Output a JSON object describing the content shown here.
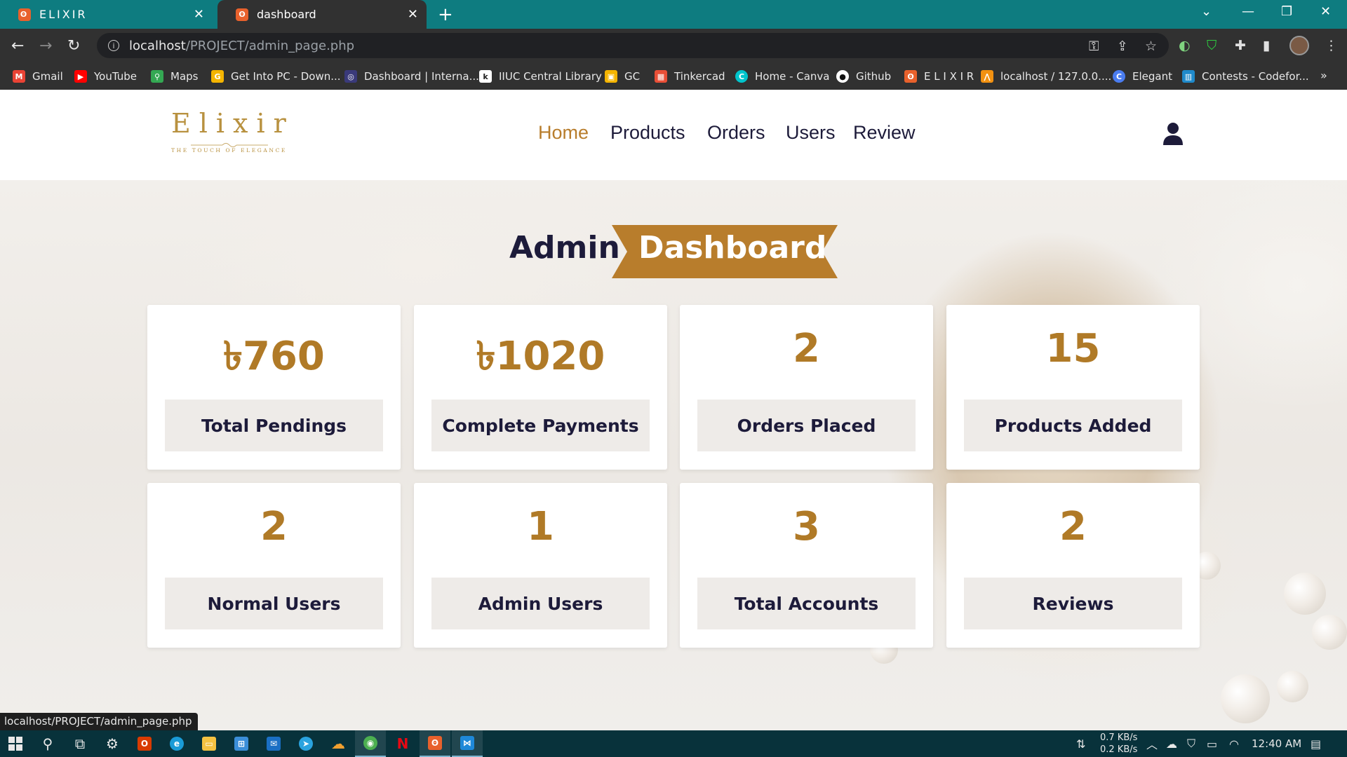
{
  "browser": {
    "tabs": [
      {
        "title": "ELIXIR",
        "active": false
      },
      {
        "title": "dashboard",
        "active": true
      }
    ],
    "url_host": "localhost",
    "url_path": "/PROJECT/admin_page.php",
    "bookmarks": [
      {
        "label": "Gmail",
        "icon": "gmail-icon",
        "color": "#ea4335"
      },
      {
        "label": "YouTube",
        "icon": "youtube-icon",
        "color": "#ff0000"
      },
      {
        "label": "Maps",
        "icon": "maps-icon",
        "color": "#34a853"
      },
      {
        "label": "Get Into PC - Down...",
        "icon": "getintopc-icon",
        "color": "#f4b400"
      },
      {
        "label": "Dashboard | Interna...",
        "icon": "iiuc-icon",
        "color": "#3a3a7a"
      },
      {
        "label": "IIUC Central Library",
        "icon": "library-icon",
        "color": "#ffffff"
      },
      {
        "label": "GC",
        "icon": "classroom-icon",
        "color": "#f4b400"
      },
      {
        "label": "Tinkercad",
        "icon": "tinkercad-icon",
        "color": "#e94f37"
      },
      {
        "label": "Home - Canva",
        "icon": "canva-icon",
        "color": "#00c4cc"
      },
      {
        "label": "Github",
        "icon": "github-icon",
        "color": "#ffffff"
      },
      {
        "label": "E L I X I R",
        "icon": "xampp-icon",
        "color": "#e8612c"
      },
      {
        "label": "localhost / 127.0.0....",
        "icon": "phpmyadmin-icon",
        "color": "#f29111"
      },
      {
        "label": "Elegant",
        "icon": "elegant-icon",
        "color": "#4a7cf0"
      },
      {
        "label": "Contests - Codefor...",
        "icon": "codeforces-icon",
        "color": "#1f8acb"
      }
    ],
    "bookmarks_overflow": "»",
    "status_url": "localhost/PROJECT/admin_page.php"
  },
  "site": {
    "logo_word": "Elixir",
    "logo_tagline": "THE TOUCH OF ELEGANCE",
    "nav": [
      {
        "label": "Home",
        "active": true
      },
      {
        "label": "Products",
        "active": false
      },
      {
        "label": "Orders",
        "active": false
      },
      {
        "label": "Users",
        "active": false
      },
      {
        "label": "Review",
        "active": false
      }
    ],
    "accent_color": "#b87d2c",
    "text_color": "#1d1b3a"
  },
  "dashboard": {
    "title_left": "Admin",
    "title_right": "Dashboard",
    "cards": [
      {
        "value": "৳760",
        "label": "Total Pendings"
      },
      {
        "value": "৳1020",
        "label": "Complete Payments"
      },
      {
        "value": "2",
        "label": "Orders Placed"
      },
      {
        "value": "15",
        "label": "Products Added"
      },
      {
        "value": "2",
        "label": "Normal Users"
      },
      {
        "value": "1",
        "label": "Admin Users"
      },
      {
        "value": "3",
        "label": "Total Accounts"
      },
      {
        "value": "2",
        "label": "Reviews"
      }
    ]
  },
  "taskbar": {
    "net_down": "0.7 KB/s",
    "net_up": "0.2 KB/s",
    "time": "12:40 AM"
  }
}
